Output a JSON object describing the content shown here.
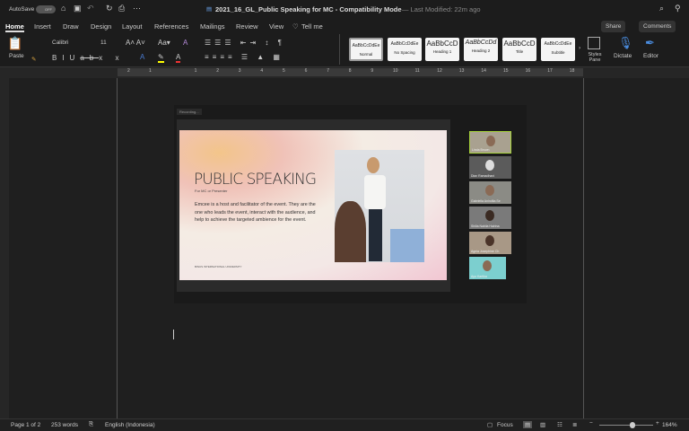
{
  "titlebar": {
    "autosave": "AutoSave",
    "toggle": "OFF",
    "doc_title": "2021_16_GL_Public Speaking for MC  -  Compatibility Mode",
    "modified": "— Last Modified: 22m ago"
  },
  "tabs": [
    "Home",
    "Insert",
    "Draw",
    "Design",
    "Layout",
    "References",
    "Mailings",
    "Review",
    "View",
    "Tell me"
  ],
  "share": "Share",
  "comments": "Comments",
  "ribbon": {
    "paste": "Paste",
    "font": "Calibri",
    "size": "11",
    "styles": [
      {
        "sample": "AaBbCcDdEe",
        "label": "Normal"
      },
      {
        "sample": "AaBbCcDdEe",
        "label": "No Spacing"
      },
      {
        "sample": "AaBbCcD",
        "label": "Heading 1"
      },
      {
        "sample": "AaBbCcDd",
        "label": "Heading 2"
      },
      {
        "sample": "AaBbCcD",
        "label": "Title"
      },
      {
        "sample": "AaBbCcDdEe",
        "label": "Subtitle"
      }
    ],
    "styles_pane": "Styles Pane",
    "dictate": "Dictate",
    "editor": "Editor"
  },
  "ruler": [
    "2",
    "1",
    "1",
    "2",
    "3",
    "4",
    "5",
    "6",
    "7",
    "8",
    "9",
    "10",
    "11",
    "12",
    "13",
    "14",
    "15",
    "16",
    "17",
    "18"
  ],
  "screenshot": {
    "recording": "Recording...",
    "slide_title": "PUBLIC SPEAKING",
    "slide_subtitle": "For MC or Presenter",
    "slide_body": "Emcee is a host and facilitator of the event. They are the one who leads the event, interact with the audience, and help to achieve the targeted  ambience for the event.",
    "slide_footer": "BINUS INTERNATIONAL UNIVERSITY",
    "participants": [
      "Linda Brown",
      "Dian Ramadhani",
      "Gabriella Anindita Se",
      "Shilla Nabila Hairina",
      "Agnia Josephine Ch",
      "Ayu Kartika"
    ]
  },
  "status": {
    "page": "Page 1 of 2",
    "words": "253 words",
    "language": "English (Indonesia)",
    "focus": "Focus",
    "zoom": "164%",
    "zoom_level": 0.62
  }
}
